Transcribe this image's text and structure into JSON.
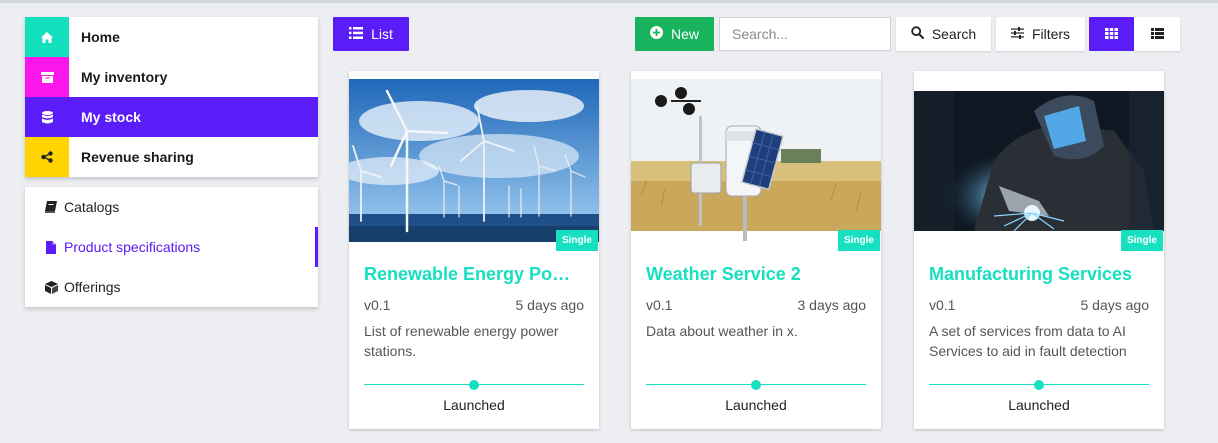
{
  "sidebar": {
    "items": [
      {
        "label": "Home",
        "icon": "home-icon",
        "color": "#14e0bf"
      },
      {
        "label": "My inventory",
        "icon": "archive-icon",
        "color": "#fb16e9"
      },
      {
        "label": "My stock",
        "icon": "database-icon",
        "color": "#5a1cf7"
      },
      {
        "label": "Revenue sharing",
        "icon": "share-icon",
        "color": "#ffd400"
      }
    ],
    "sub_items": [
      {
        "label": "Catalogs",
        "icon": "book-icon"
      },
      {
        "label": "Product specifications",
        "icon": "file-icon"
      },
      {
        "label": "Offerings",
        "icon": "cube-icon"
      }
    ]
  },
  "toolbar": {
    "list_label": "List",
    "new_label": "New",
    "search_placeholder": "Search...",
    "search_label": "Search",
    "filters_label": "Filters"
  },
  "cards": [
    {
      "title": "Renewable Energy Power Stations",
      "tag": "Single",
      "version": "v0.1",
      "age": "5 days ago",
      "description": "List of renewable energy power stations.",
      "status": "Launched"
    },
    {
      "title": "Weather Service 2",
      "tag": "Single",
      "version": "v0.1",
      "age": "3 days ago",
      "description": "Data about weather in x.",
      "status": "Launched"
    },
    {
      "title": "Manufacturing Services",
      "tag": "Single",
      "version": "v0.1",
      "age": "5 days ago",
      "description": "A set of services from data to AI Services to aid in fault detection",
      "status": "Launched"
    }
  ],
  "colors": {
    "accent": "#5a1cf7",
    "teal": "#16e0c0",
    "green": "#19b35d"
  }
}
